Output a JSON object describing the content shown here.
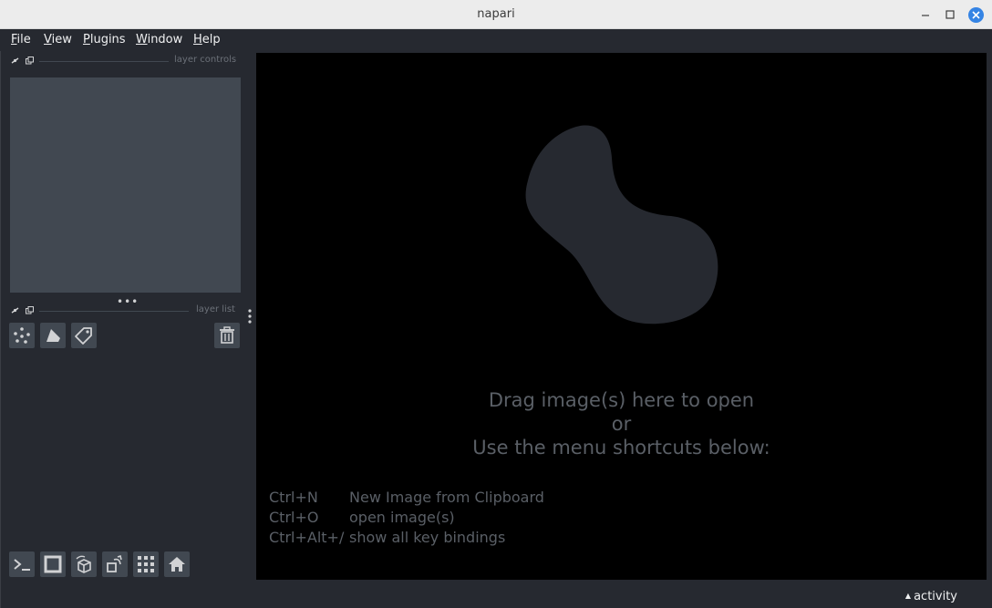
{
  "window": {
    "title": "napari"
  },
  "menubar": {
    "items": [
      {
        "label": "File",
        "mnemonic": "F",
        "rest": "ile"
      },
      {
        "label": "View",
        "mnemonic": "V",
        "rest": "iew"
      },
      {
        "label": "Plugins",
        "mnemonic": "P",
        "rest": "lugins"
      },
      {
        "label": "Window",
        "mnemonic": "W",
        "rest": "indow"
      },
      {
        "label": "Help",
        "mnemonic": "H",
        "rest": "elp"
      }
    ]
  },
  "layer_controls": {
    "label": "layer controls"
  },
  "layer_list": {
    "label": "layer list",
    "buttons": [
      {
        "icon": "new-points-icon"
      },
      {
        "icon": "new-shapes-icon"
      },
      {
        "icon": "new-labels-icon"
      }
    ],
    "delete_icon": "trash-icon"
  },
  "canvas": {
    "welcome_line1": "Drag image(s) here to open",
    "welcome_line2": "or",
    "welcome_line3": "Use the menu shortcuts below:",
    "shortcuts": [
      {
        "key": "Ctrl+N",
        "desc": "New Image from Clipboard"
      },
      {
        "key": "Ctrl+O",
        "desc": "open image(s)"
      },
      {
        "key": "Ctrl+Alt+/",
        "desc": "show all key bindings"
      }
    ]
  },
  "viewer_buttons": [
    {
      "icon": "console-icon"
    },
    {
      "icon": "ndisplay-icon"
    },
    {
      "icon": "roll-dims-icon"
    },
    {
      "icon": "transpose-icon"
    },
    {
      "icon": "grid-icon"
    },
    {
      "icon": "home-icon"
    }
  ],
  "status": {
    "activity_label": "activity"
  },
  "colors": {
    "background": "#262930",
    "panel": "#414851",
    "canvas": "#000000",
    "close_button": "#3584e4"
  }
}
